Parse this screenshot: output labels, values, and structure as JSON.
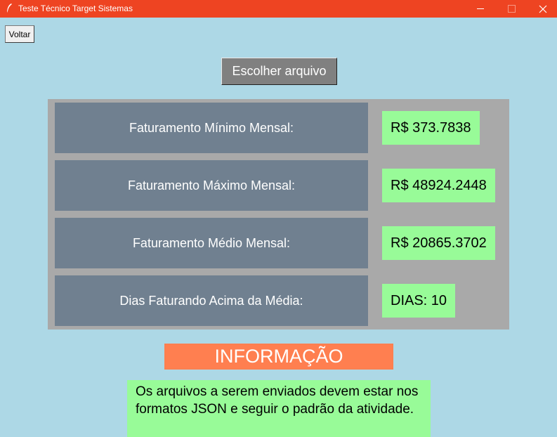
{
  "window": {
    "title": "Teste Técnico Target Sistemas",
    "titlebar_color": "#ee4422"
  },
  "toolbar": {
    "back_label": "Voltar",
    "choose_file_label": "Escolher arquivo"
  },
  "results": {
    "min": {
      "label": "Faturamento Mínimo Mensal:",
      "value": "R$ 373.7838"
    },
    "max": {
      "label": "Faturamento Máximo Mensal:",
      "value": "R$ 48924.2448"
    },
    "avg": {
      "label": "Faturamento Médio Mensal:",
      "value": "R$ 20865.3702"
    },
    "days": {
      "label": "Dias Faturando Acima da Média:",
      "value": "DIAS: 10"
    }
  },
  "info": {
    "title": "INFORMAÇÃO",
    "text": "Os arquivos a serem enviados devem estar nos formatos JSON e seguir o padrão da atividade."
  },
  "colors": {
    "background": "#add8e6",
    "panel": "#a9a9a9",
    "label_bg": "#708090",
    "value_bg": "#98fb98",
    "info_title_bg": "#ff7f50"
  },
  "icons": [
    "feather-icon",
    "minimize-icon",
    "maximize-icon",
    "close-icon"
  ]
}
